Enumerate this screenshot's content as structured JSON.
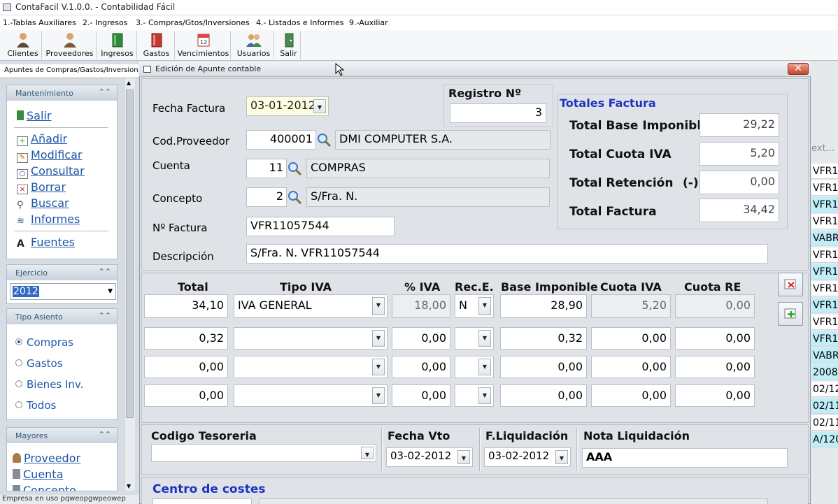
{
  "app": {
    "title": "ContaFacil V.1.0.0. - Contabilidad Fácil"
  },
  "menu": [
    "1.-Tablas Auxiliares",
    "2.- Ingresos",
    "3.- Compras/Gtos/Inversiones",
    "4.- Listados e Informes",
    "9.-Auxiliar"
  ],
  "toolbar": [
    "Clientes",
    "Proveedores",
    "Ingresos",
    "Gastos",
    "Vencimientos",
    "Usuarios",
    "Salir"
  ],
  "left": {
    "tab": "Apuntes de Compras/Gastos/Inversiones",
    "mantenimiento": {
      "title": "Mantenimiento",
      "items": [
        "Salir",
        "Añadir",
        "Modificar",
        "Consultar",
        "Borrar",
        "Buscar",
        "Informes",
        "Fuentes"
      ]
    },
    "ejercicio": {
      "title": "Ejercicio",
      "value": "2012"
    },
    "tipo_asiento": {
      "title": "Tipo Asiento",
      "options": [
        "Compras",
        "Gastos",
        "Bienes Inv.",
        "Todos"
      ],
      "selected": "Compras"
    },
    "mayores": {
      "title": "Mayores",
      "items": [
        "Proveedor",
        "Cuenta",
        "Concepto"
      ]
    }
  },
  "status": "Empresa en uso pqweopgwpeowep",
  "right_list": {
    "header": "ext...",
    "rows": [
      "VFR1",
      "VFR1",
      "VFR1",
      "VFR1",
      "VABR",
      "VFR1",
      "VFR1",
      "VFR1",
      "VFR1",
      "VFR1",
      "VFR1",
      "VABR",
      "2008",
      "02/12",
      "02/11",
      "02/11",
      "A/120"
    ],
    "highlight": [
      "#ffffff",
      "#ffffff",
      "#bfeef8",
      "#ffffff",
      "#bfeef8",
      "#ffffff",
      "#bfeef8",
      "#ffffff",
      "#bfeef8",
      "#ffffff",
      "#bfeef8",
      "#bfeef8",
      "#bfeef8",
      "#ffffff",
      "#bfeef8",
      "#ffffff",
      "#bfeef8"
    ]
  },
  "dialog": {
    "title": "Edición de Apunte contable",
    "fecha_factura": {
      "label": "Fecha Factura",
      "value": "03-01-2012"
    },
    "registro": {
      "label": "Registro Nº",
      "value": "3"
    },
    "cod_proveedor": {
      "label": "Cod.Proveedor",
      "code": "400001",
      "name": "DMI COMPUTER S.A."
    },
    "cuenta": {
      "label": "Cuenta",
      "code": "11",
      "name": "COMPRAS"
    },
    "concepto": {
      "label": "Concepto",
      "code": "2",
      "name": "S/Fra. N."
    },
    "num_factura": {
      "label": "Nº Factura",
      "value": "VFR11057544"
    },
    "descripcion": {
      "label": "Descripción",
      "value": "S/Fra. N. VFR11057544"
    },
    "totales": {
      "title": "Totales Factura",
      "base_label": "Total Base Imponible",
      "base": "29,22",
      "iva_label": "Total Cuota IVA",
      "iva": "5,20",
      "ret_label": "Total Retención",
      "ret_sign": "(-)",
      "ret": "0,00",
      "total_label": "Total Factura",
      "total": "34,42"
    },
    "grid": {
      "headers": [
        "Total",
        "Tipo IVA",
        "% IVA",
        "Rec.E.",
        "Base Imponible",
        "Cuota IVA",
        "Cuota RE"
      ],
      "rows": [
        {
          "total": "34,10",
          "tipo": "IVA GENERAL",
          "pct": "18,00",
          "rec": "N",
          "base": "28,90",
          "cuota": "5,20",
          "re": "0,00"
        },
        {
          "total": "0,32",
          "tipo": "",
          "pct": "0,00",
          "rec": "",
          "base": "0,32",
          "cuota": "0,00",
          "re": "0,00"
        },
        {
          "total": "0,00",
          "tipo": "",
          "pct": "0,00",
          "rec": "",
          "base": "0,00",
          "cuota": "0,00",
          "re": "0,00"
        },
        {
          "total": "0,00",
          "tipo": "",
          "pct": "0,00",
          "rec": "",
          "base": "0,00",
          "cuota": "0,00",
          "re": "0,00"
        }
      ]
    },
    "tesoreria": {
      "label": "Codigo Tesoreria",
      "value": ""
    },
    "fecha_vto": {
      "label": "Fecha Vto",
      "value": "03-02-2012"
    },
    "f_liquidacion": {
      "label": "F.Liquidación",
      "value": "03-02-2012"
    },
    "nota_liquidacion": {
      "label": "Nota Liquidación",
      "value": "AAA"
    },
    "centro_costes": {
      "label": "Centro de costes"
    }
  }
}
